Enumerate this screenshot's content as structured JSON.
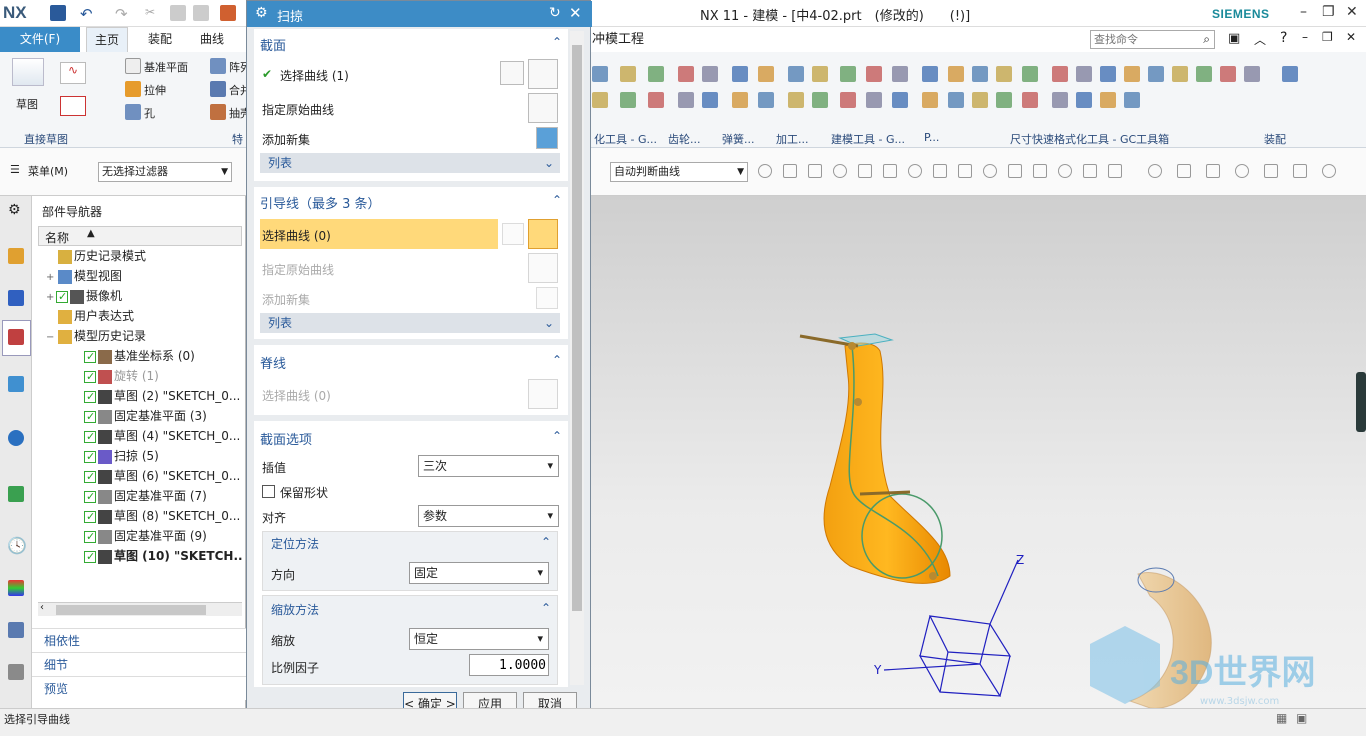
{
  "titlebar": {
    "logo": "NX",
    "title": "NX 11 - 建模 - [中4-02.prt　(修改的)　　(!)]",
    "brand": "SIEMENS",
    "min": "–",
    "restore": "❐",
    "close": "✕"
  },
  "ribbon": {
    "file_tab": "文件(F)",
    "tabs": [
      "主页",
      "装配",
      "曲线"
    ],
    "right_tab": "冲模工程",
    "search_placeholder": "查找命令",
    "sketch_label": "草图",
    "group_direct_sketch": "直接草图",
    "group_feature": "特",
    "items": {
      "datum": "基准平面",
      "extrude": "拉伸",
      "hole": "孔",
      "array": "阵列",
      "combine": "合并",
      "shell": "抽壳"
    },
    "groups_right": [
      "化工具 - G...",
      "齿轮...",
      "弹簧...",
      "加工...",
      "建模工具 - G...",
      "P...",
      "尺寸快速格式化工具 - GC工具箱",
      "装配"
    ]
  },
  "toolbar2": {
    "menu": "菜单(M)",
    "filter": "无选择过滤器",
    "curve_rule": "自动判断曲线"
  },
  "navigator": {
    "title": "部件导航器",
    "col_name": "名称",
    "items": [
      {
        "label": "历史记录模式",
        "indent": 0,
        "check": false,
        "expand": ""
      },
      {
        "label": "模型视图",
        "indent": 0,
        "check": false,
        "expand": "+"
      },
      {
        "label": "摄像机",
        "indent": 0,
        "check": true,
        "expand": "+"
      },
      {
        "label": "用户表达式",
        "indent": 0,
        "check": false,
        "expand": ""
      },
      {
        "label": "模型历史记录",
        "indent": 0,
        "check": false,
        "expand": "-"
      },
      {
        "label": "基准坐标系 (0)",
        "indent": 1,
        "check": true,
        "expand": ""
      },
      {
        "label": "旋转 (1)",
        "indent": 1,
        "check": true,
        "expand": ""
      },
      {
        "label": "草图 (2) \"SKETCH_0...",
        "indent": 1,
        "check": true,
        "expand": ""
      },
      {
        "label": "固定基准平面 (3)",
        "indent": 1,
        "check": true,
        "expand": ""
      },
      {
        "label": "草图 (4) \"SKETCH_0...",
        "indent": 1,
        "check": true,
        "expand": ""
      },
      {
        "label": "扫掠 (5)",
        "indent": 1,
        "check": true,
        "expand": ""
      },
      {
        "label": "草图 (6) \"SKETCH_0...",
        "indent": 1,
        "check": true,
        "expand": ""
      },
      {
        "label": "固定基准平面 (7)",
        "indent": 1,
        "check": true,
        "expand": ""
      },
      {
        "label": "草图 (8) \"SKETCH_0...",
        "indent": 1,
        "check": true,
        "expand": ""
      },
      {
        "label": "固定基准平面 (9)",
        "indent": 1,
        "check": true,
        "expand": ""
      },
      {
        "label": "草图 (10) \"SKETCH...",
        "indent": 1,
        "check": true,
        "expand": ""
      }
    ],
    "sections": [
      "相依性",
      "细节",
      "预览"
    ]
  },
  "dialog": {
    "title": "扫掠",
    "section": {
      "header": "截面",
      "select": "选择曲线 (1)",
      "origin": "指定原始曲线",
      "addnew": "添加新集",
      "list": "列表"
    },
    "guide": {
      "header": "引导线（最多 3 条）",
      "select": "选择曲线 (0)",
      "origin": "指定原始曲线",
      "addnew": "添加新集",
      "list": "列表"
    },
    "spine": {
      "header": "脊线",
      "select": "选择曲线 (0)"
    },
    "options": {
      "header": "截面选项",
      "interp_label": "插值",
      "interp_value": "三次",
      "keep_shape": "保留形状",
      "align_label": "对齐",
      "align_value": "参数",
      "orient_header": "定位方法",
      "dir_label": "方向",
      "dir_value": "固定",
      "scale_header": "缩放方法",
      "scale_label": "缩放",
      "scale_value": "恒定",
      "factor_label": "比例因子",
      "factor_value": "1.0000"
    },
    "ok": "< 确定 >",
    "apply": "应用",
    "cancel": "取消"
  },
  "viewport": {
    "axis_z": "Z",
    "axis_y": "Y",
    "watermark": "3D世界网",
    "watermark_url": "www.3dsjw.com"
  },
  "status": {
    "text": "选择引导曲线"
  },
  "colors": {
    "accent": "#3d8cc6",
    "highlight": "#ffd97a",
    "model": "#f59a10"
  }
}
